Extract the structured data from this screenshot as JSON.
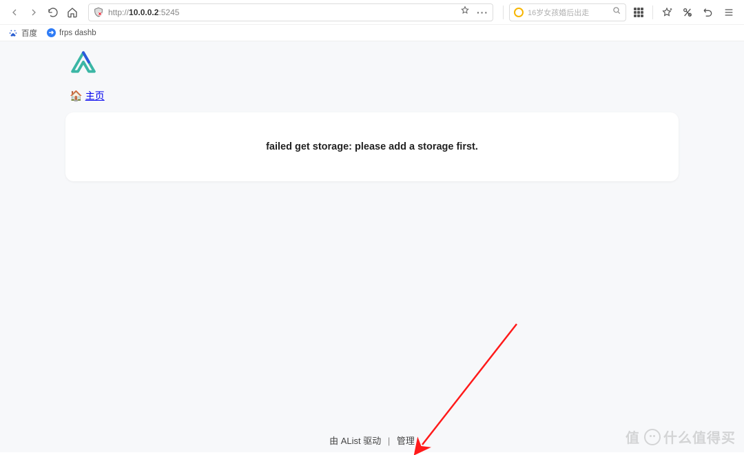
{
  "browser": {
    "url_prefix": "http://",
    "url_host": "10.0.0.2",
    "url_port": ":5245",
    "search_placeholder": "16岁女孩婚后出走"
  },
  "bookmarks": {
    "baidu": "百度",
    "frps": "frps dashb"
  },
  "page": {
    "breadcrumb_home": "主页",
    "error_message": "failed get storage: please add a storage first."
  },
  "footer": {
    "powered_text": "由 AList 驱动",
    "separator": "|",
    "admin_link": "管理"
  },
  "watermark": "什么值得买"
}
